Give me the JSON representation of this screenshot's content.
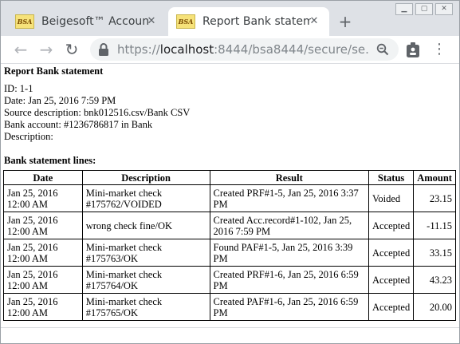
{
  "browser": {
    "tabs": [
      {
        "label": "Beigesoft™ Accounting",
        "favicon_text": "BSA",
        "active": false
      },
      {
        "label": "Report Bank statement",
        "favicon_text": "BSA",
        "active": true
      }
    ],
    "new_tab_label": "+",
    "url_scheme": "https://",
    "url_host": "localhost",
    "url_rest": ":8444/bsa8444/secure/se..."
  },
  "page": {
    "title": "Report Bank statement",
    "details": [
      "ID: 1-1",
      "Date: Jan 25, 2016 7:59 PM",
      "Source description: bnk012516.csv/Bank CSV",
      "Bank account: #1236786817 in Bank",
      "Description:"
    ],
    "lines_heading": "Bank statement lines:",
    "columns": [
      "Date",
      "Description",
      "Result",
      "Status",
      "Amount"
    ],
    "rows": [
      {
        "date": "Jan 25, 2016 12:00 AM",
        "description": "Mini-market check #175762/VOIDED",
        "result": "Created PRF#1-5, Jan 25, 2016 3:37 PM",
        "status": "Voided",
        "amount": "23.15"
      },
      {
        "date": "Jan 25, 2016 12:00 AM",
        "description": "wrong check fine/OK",
        "result": "Created Acc.record#1-102, Jan 25, 2016 7:59 PM",
        "status": "Accepted",
        "amount": "-11.15"
      },
      {
        "date": "Jan 25, 2016 12:00 AM",
        "description": "Mini-market check #175763/OK",
        "result": "Found PAF#1-5, Jan 25, 2016 3:39 PM",
        "status": "Accepted",
        "amount": "33.15"
      },
      {
        "date": "Jan 25, 2016 12:00 AM",
        "description": "Mini-market check #175764/OK",
        "result": "Created PRF#1-6, Jan 25, 2016 6:59 PM",
        "status": "Accepted",
        "amount": "43.23"
      },
      {
        "date": "Jan 25, 2016 12:00 AM",
        "description": "Mini-market check #175765/OK",
        "result": "Created PAF#1-6, Jan 25, 2016 6:59 PM",
        "status": "Accepted",
        "amount": "20.00"
      }
    ]
  },
  "icons": [
    "back-arrow-icon",
    "forward-arrow-icon",
    "reload-icon",
    "lock-icon",
    "zoom-icon",
    "extension-icon",
    "menu-icon",
    "close-icon"
  ]
}
